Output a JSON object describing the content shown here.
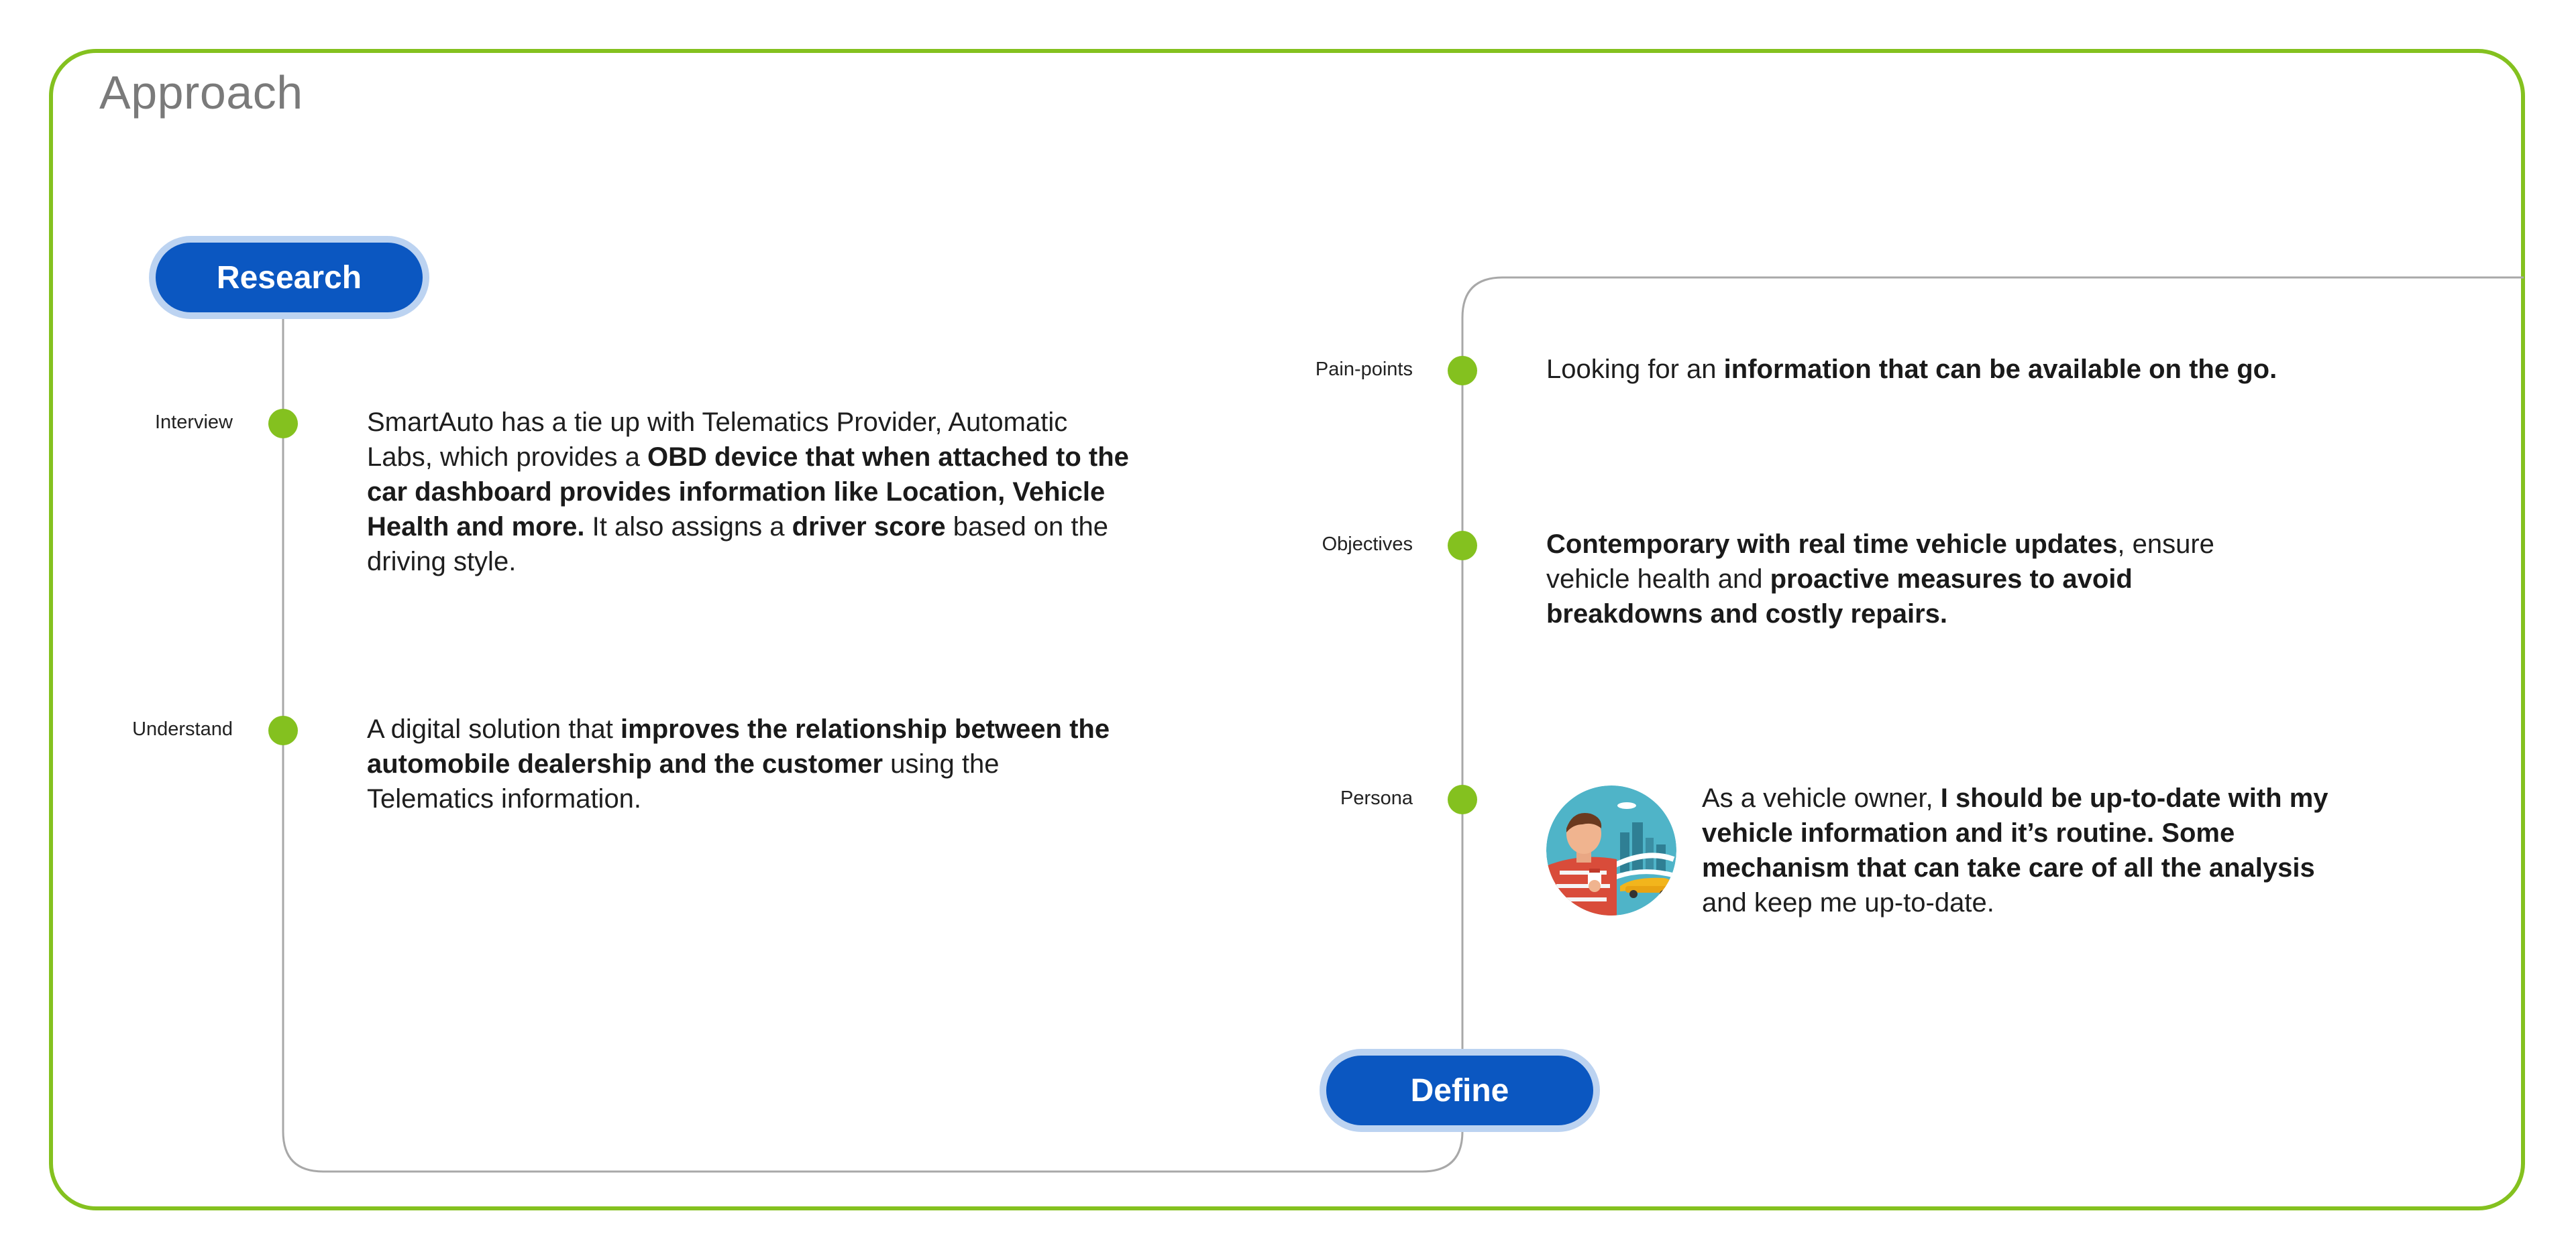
{
  "title": "Approach",
  "stages": {
    "research": "Research",
    "define": "Define"
  },
  "research_items": [
    {
      "label": "Interview",
      "text": [
        {
          "t": "SmartAuto has a tie up with Telematics Provider, Automatic Labs, which provides a ",
          "b": false
        },
        {
          "t": "OBD device that when attached to the car dashboard provides information like Location, Vehicle Health and more.",
          "b": true
        },
        {
          "t": " It also assigns a ",
          "b": false
        },
        {
          "t": "driver score",
          "b": true
        },
        {
          "t": " based on the driving style.",
          "b": false
        }
      ]
    },
    {
      "label": "Understand",
      "text": [
        {
          "t": "A digital solution that ",
          "b": false
        },
        {
          "t": "improves the relationship between the automobile dealership and the customer",
          "b": true
        },
        {
          "t": " using the Telematics information.",
          "b": false
        }
      ]
    }
  ],
  "define_items": [
    {
      "label": "Pain-points",
      "text": [
        {
          "t": "Looking for an ",
          "b": false
        },
        {
          "t": "information that can be available on the go.",
          "b": true
        }
      ]
    },
    {
      "label": "Objectives",
      "text": [
        {
          "t": "Contemporary with real time vehicle updates",
          "b": true
        },
        {
          "t": ", ensure vehicle health and ",
          "b": false
        },
        {
          "t": "proactive measures to avoid breakdowns and costly repairs.",
          "b": true
        }
      ]
    },
    {
      "label": "Persona",
      "text": [
        {
          "t": "As a vehicle owner, ",
          "b": false
        },
        {
          "t": "I should be up-to-date with my vehicle information and it’s routine. Some mechanism that can take care of all the analysis",
          "b": true
        },
        {
          "t": " and keep me up-to-date.",
          "b": false
        }
      ]
    }
  ],
  "colors": {
    "frame": "#84c11f",
    "dot": "#84c11f",
    "pill": "#0b57c1",
    "pill_halo": "#bcd3f1",
    "connector": "#a8a8a8"
  },
  "icons": {
    "persona_avatar": "persona-avatar-illustration"
  }
}
